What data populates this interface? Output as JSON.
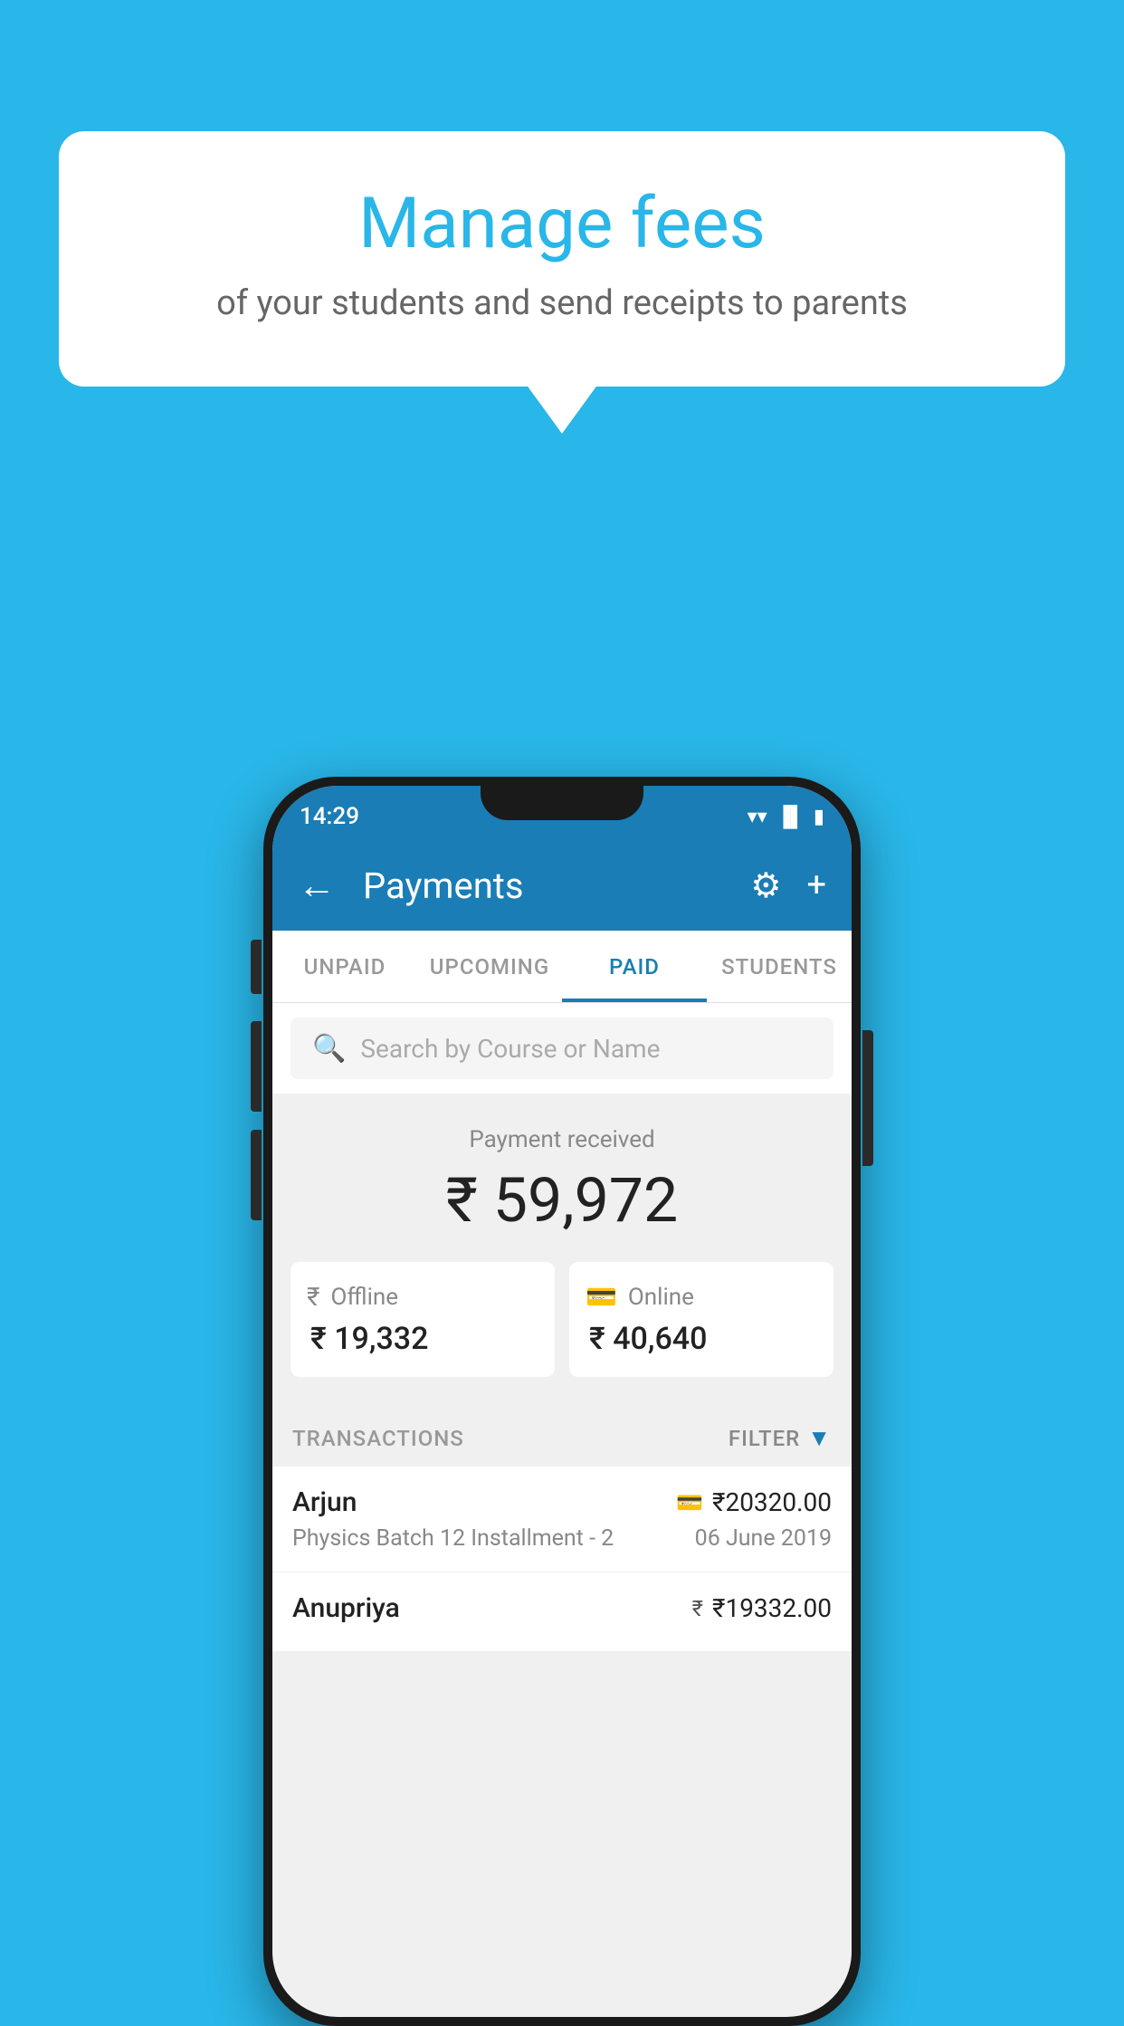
{
  "background_color": "#29b6e8",
  "bubble": {
    "title": "Manage fees",
    "subtitle": "of your students and send receipts to parents"
  },
  "status_bar": {
    "time": "14:29",
    "icons": [
      "wifi",
      "signal",
      "battery"
    ]
  },
  "app_bar": {
    "title": "Payments",
    "back_label": "←",
    "settings_label": "⚙",
    "add_label": "+"
  },
  "tabs": [
    {
      "label": "UNPAID",
      "active": false
    },
    {
      "label": "UPCOMING",
      "active": false
    },
    {
      "label": "PAID",
      "active": true
    },
    {
      "label": "STUDENTS",
      "active": false
    }
  ],
  "search": {
    "placeholder": "Search by Course or Name"
  },
  "payment_summary": {
    "label": "Payment received",
    "total": "₹ 59,972",
    "offline_label": "Offline",
    "offline_amount": "₹ 19,332",
    "online_label": "Online",
    "online_amount": "₹ 40,640"
  },
  "transactions_section": {
    "label": "TRANSACTIONS",
    "filter_label": "FILTER"
  },
  "transactions": [
    {
      "name": "Arjun",
      "amount": "₹20320.00",
      "payment_type": "online",
      "course": "Physics Batch 12 Installment - 2",
      "date": "06 June 2019"
    },
    {
      "name": "Anupriya",
      "amount": "₹19332.00",
      "payment_type": "offline",
      "course": "",
      "date": ""
    }
  ]
}
